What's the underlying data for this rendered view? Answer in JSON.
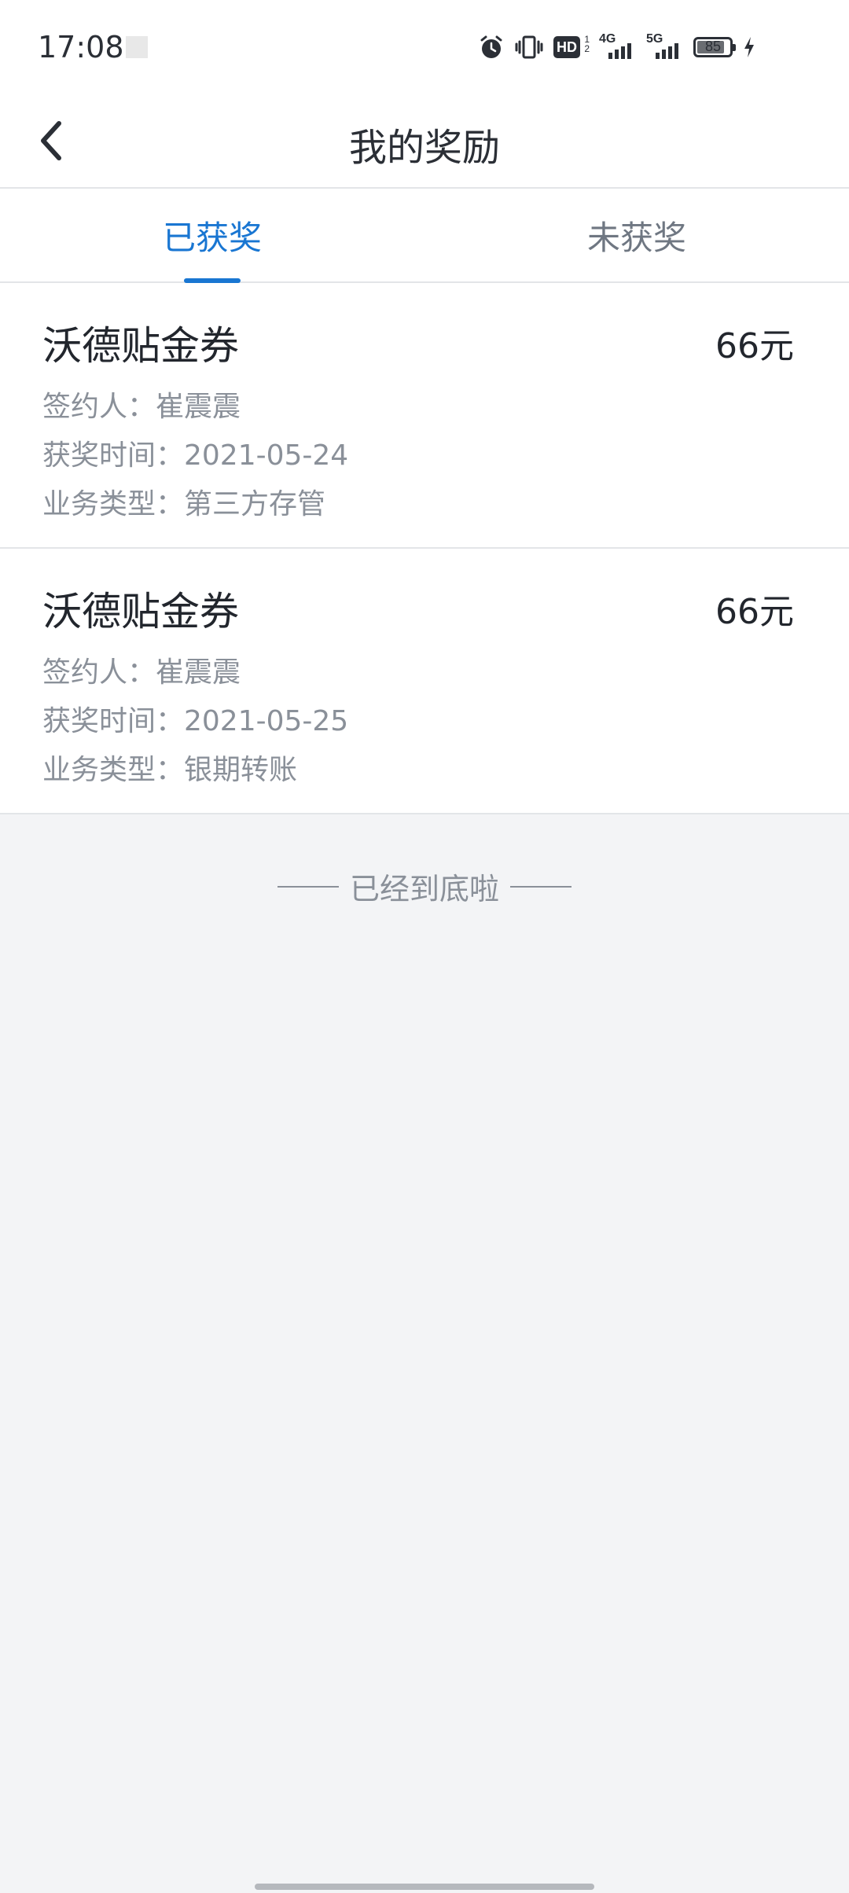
{
  "status_bar": {
    "time": "17:08",
    "battery_level": "85",
    "icons": [
      "alarm-icon",
      "vibrate-icon",
      "hd-icon",
      "signal-4g-icon",
      "signal-5g-icon",
      "battery-icon",
      "charging-icon"
    ],
    "hd_label": "HD",
    "net1_label": "4G",
    "net2_label": "5G"
  },
  "header": {
    "title": "我的奖励",
    "back_icon": "chevron-left-icon"
  },
  "tabs": [
    {
      "label": "已获奖",
      "active": true
    },
    {
      "label": "未获奖",
      "active": false
    }
  ],
  "colors": {
    "accent": "#1976d2",
    "background": "#f3f4f6",
    "secondary_text": "#8a9099"
  },
  "rewards": [
    {
      "name": "沃德贴金券",
      "amount": "66元",
      "signer": "签约人：崔震震",
      "award_time": "获奖时间：2021-05-24",
      "business_type": "业务类型：第三方存管"
    },
    {
      "name": "沃德贴金券",
      "amount": "66元",
      "signer": "签约人：崔震震",
      "award_time": "获奖时间：2021-05-25",
      "business_type": "业务类型：银期转账"
    }
  ],
  "end_of_list": "已经到底啦"
}
